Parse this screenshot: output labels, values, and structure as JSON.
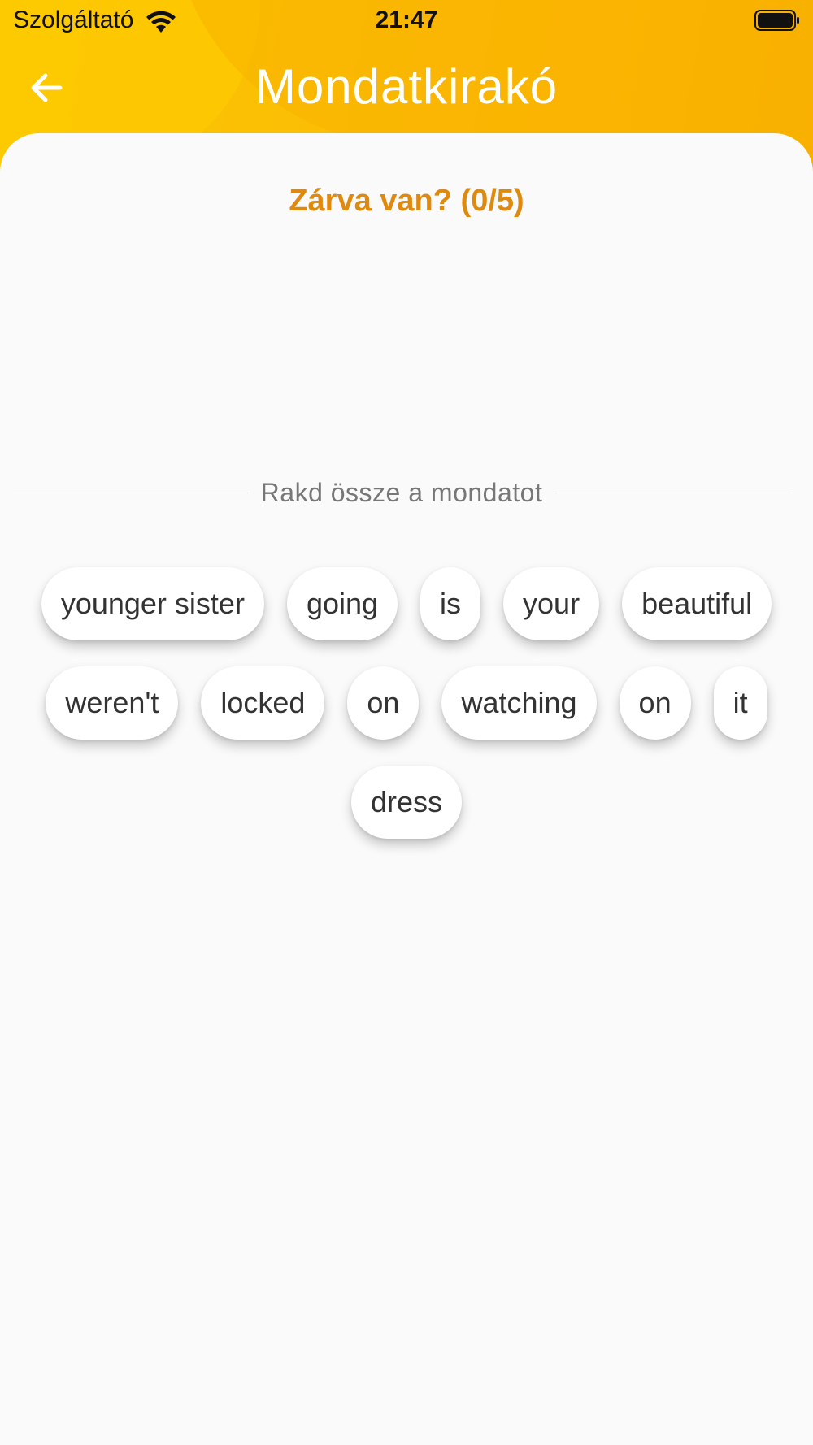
{
  "status_bar": {
    "carrier": "Szolgáltató",
    "time": "21:47",
    "wifi_icon": "wifi-icon",
    "battery_icon": "battery-icon"
  },
  "header": {
    "title": "Mondatkirakó",
    "back_icon": "arrow-left-icon",
    "colors": {
      "start": "#fbc700",
      "end": "#f9ae00"
    }
  },
  "question": {
    "text": "Zárva van? (0/5)",
    "color": "#df8a0e"
  },
  "answer": {
    "words": []
  },
  "divider": {
    "label": "Rakd össze a mondatot"
  },
  "word_bank": {
    "words": [
      "younger sister",
      "going",
      "is",
      "your",
      "beautiful",
      "weren't",
      "locked",
      "on",
      "watching",
      "on",
      "it",
      "dress"
    ]
  }
}
